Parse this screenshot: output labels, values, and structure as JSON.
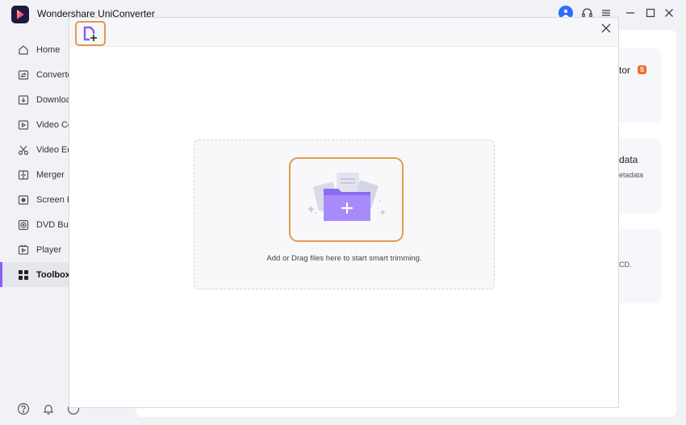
{
  "app": {
    "title": "Wondershare UniConverter"
  },
  "sidebar": {
    "items": [
      {
        "label": "Home",
        "icon": "home-icon"
      },
      {
        "label": "Converter",
        "icon": "converter-icon"
      },
      {
        "label": "Downloader",
        "icon": "download-icon"
      },
      {
        "label": "Video Compressor",
        "icon": "video-compress-icon"
      },
      {
        "label": "Video Editor",
        "icon": "scissors-icon"
      },
      {
        "label": "Merger",
        "icon": "merge-icon"
      },
      {
        "label": "Screen Recorder",
        "icon": "screen-record-icon"
      },
      {
        "label": "DVD Burner",
        "icon": "disc-icon"
      },
      {
        "label": "Player",
        "icon": "play-icon"
      },
      {
        "label": "Toolbox",
        "icon": "grid-icon",
        "active": true
      }
    ]
  },
  "background_cards": {
    "card1": {
      "title": "tor",
      "badge": "S"
    },
    "card2": {
      "title": "data",
      "subtitle": "etadata"
    },
    "card3": {
      "subtitle": "CD."
    }
  },
  "dialog": {
    "drop_hint": "Add or Drag files here to start smart trimming."
  },
  "colors": {
    "accent": "#8b5cf6",
    "highlight": "#e39a4f",
    "folder": "#a78bfa",
    "badge": "#f06a2c"
  }
}
